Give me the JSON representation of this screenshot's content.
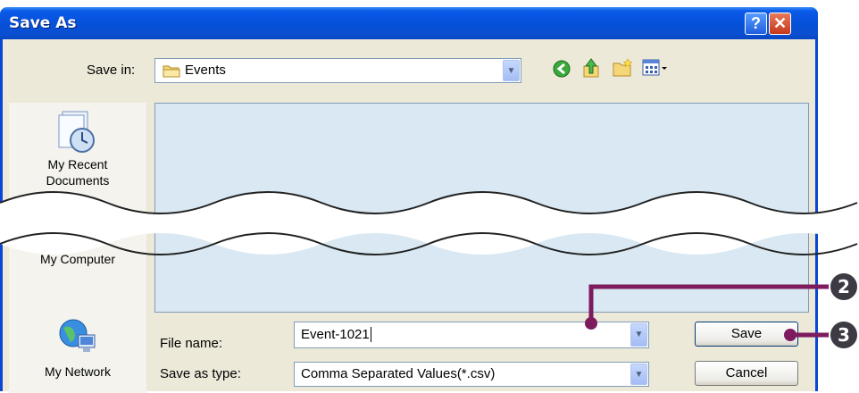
{
  "window": {
    "title": "Save As"
  },
  "titlebar": {
    "help_glyph": "?",
    "close_glyph": "✕"
  },
  "save_in": {
    "label": "Save in:",
    "value": "Events",
    "icon": "folder-icon"
  },
  "toolbar": {
    "icons": [
      "back-icon",
      "up-folder-icon",
      "new-folder-icon",
      "views-menu-icon"
    ]
  },
  "places": [
    {
      "label_line1": "My Recent",
      "label_line2": "Documents",
      "icon": "recent-documents-icon"
    },
    {
      "label_line1": "My Computer",
      "icon": "computer-icon"
    },
    {
      "label_line1": "My Network",
      "icon": "network-icon"
    }
  ],
  "file_name": {
    "label": "File name:",
    "value": "Event-1021"
  },
  "save_as_type": {
    "label": "Save as type:",
    "value": "Comma Separated Values(*.csv)"
  },
  "buttons": {
    "save": "Save",
    "cancel": "Cancel"
  },
  "callouts": [
    "2",
    "3"
  ],
  "colors": {
    "titlebar": "#0a5ae8",
    "callout": "#7d1b5e",
    "file_area": "#d9e8f2"
  }
}
